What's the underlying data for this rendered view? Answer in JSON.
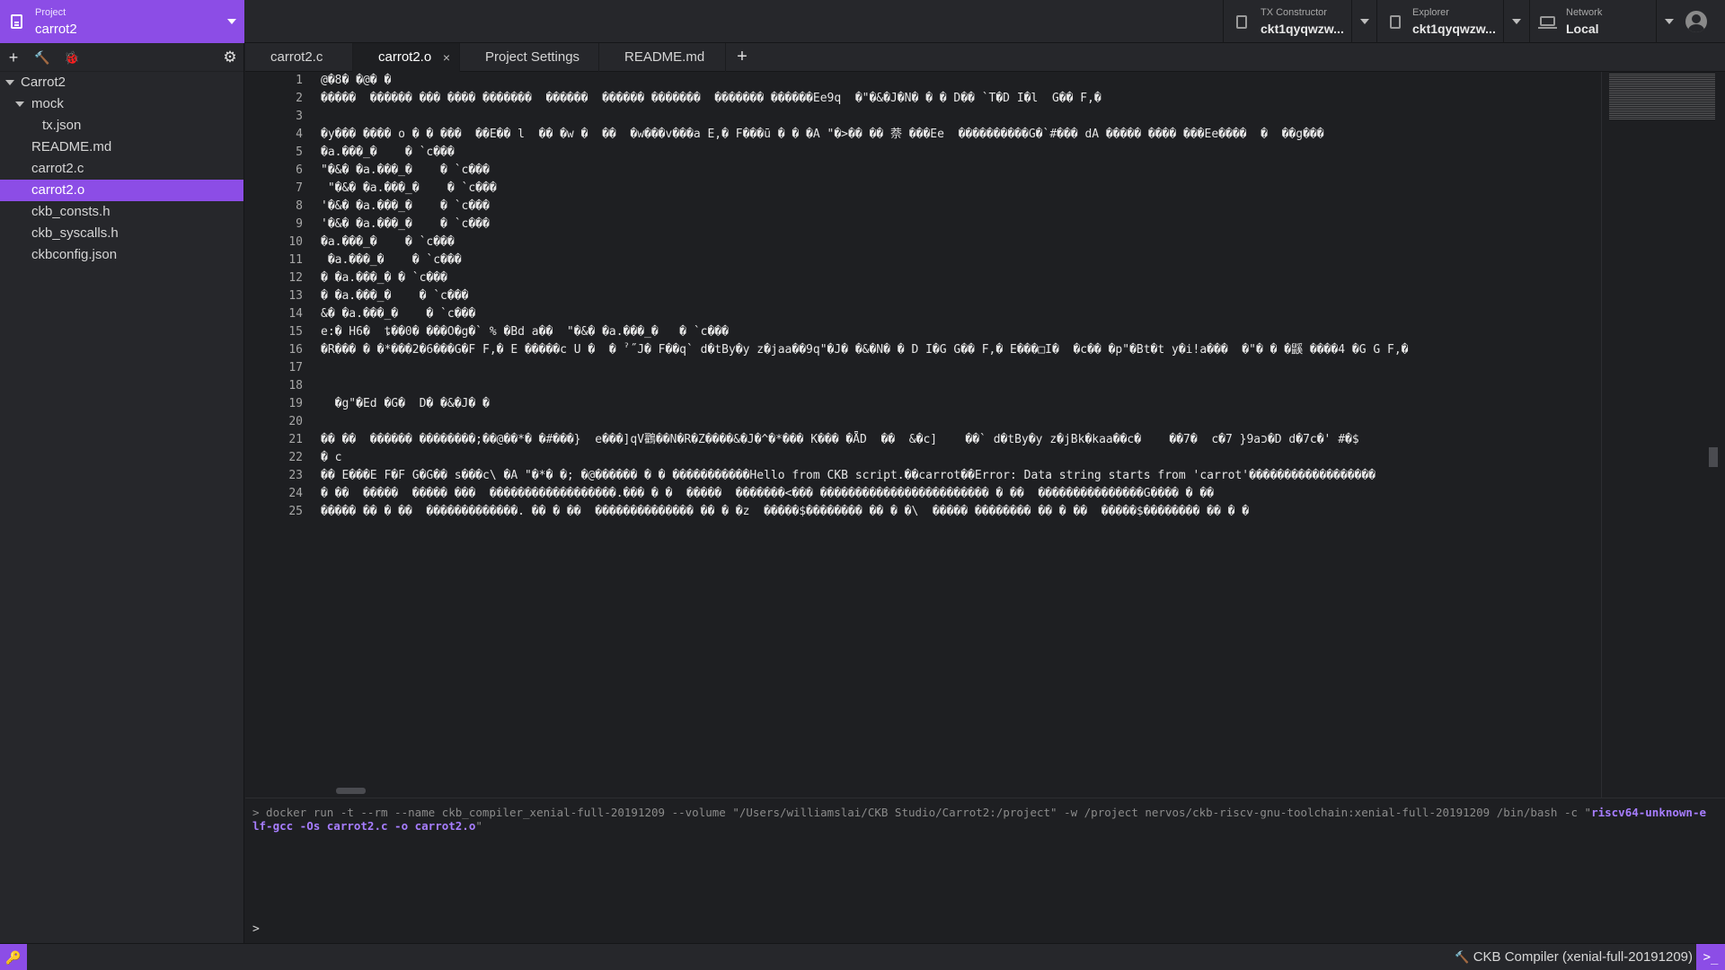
{
  "project_selector": {
    "caption": "Project",
    "value": "carrot2"
  },
  "tx_constructor": {
    "caption": "TX Constructor",
    "value": "ckt1qyqwzw..."
  },
  "explorer": {
    "caption": "Explorer",
    "value": "ckt1qyqwzw..."
  },
  "network": {
    "caption": "Network",
    "value": "Local"
  },
  "sidebar": {
    "toolbar": {
      "add": "+",
      "build": "🔨",
      "debug": "🐞",
      "settings": "⚙"
    },
    "tree": [
      {
        "label": "Carrot2",
        "expanded": true
      },
      {
        "label": "mock",
        "expanded": true
      },
      {
        "label": "tx.json"
      },
      {
        "label": "README.md"
      },
      {
        "label": "carrot2.c"
      },
      {
        "label": "carrot2.o",
        "selected": true
      },
      {
        "label": "ckb_consts.h"
      },
      {
        "label": "ckb_syscalls.h"
      },
      {
        "label": "ckbconfig.json"
      }
    ]
  },
  "tabs": [
    {
      "label": "carrot2.c"
    },
    {
      "label": "carrot2.o",
      "active": true,
      "close": "×"
    },
    {
      "label": "Project Settings"
    },
    {
      "label": "README.md"
    }
  ],
  "add_tab": "+",
  "editor": {
    "lines": [
      "@�8� �@� �",
      "�����  ������ ��� ���� �������  ������  ������ �������  ������� ������Ee9q  �\"�&�J�N� � � D�� `T�D I�l  G�� F,�",
      "",
      "�y��� ���� o � � ���  ��E�� l  �� �w �  ��  �w���v���a E,� F���ū � � �A \"�>�� �� 萘 ���Ee  ����������G�`#��� dA ����� ���� ���Ee����  �  ��g���",
      "�a.���_�    � `c���",
      "\"�&� �a.���_�    � `c���",
      " \"�&� �a.���_�    � `c���",
      "'�&� �a.���_�    � `c���",
      "'�&� �a.���_�    � `c���",
      "�a.���_�    � `c���",
      " �a.���_�    � `c���",
      "� �a.���_� � `c���",
      "� �a.���_�    � `c���",
      "&� �a.���_�    � `c���",
      "e:� H6�  ȶ��0� ���O�g�` % �Bd a��  \"�&� �a.���_�   � `c���",
      "�R��� � �*���2�6���G�F F,� E �����c U �  � ˀ˝J� F��q` d�tBy�y z�jaa��9q\"�J� �&�N� � D I�G G�� F,� E���□I�  �c�� �p\"�Bt�t y�i!a���  �\"� � �鼷 ����4 �G G F,�",
      "",
      "",
      "  �g\"�Ed �G�  D� �&�J� �",
      "",
      "�� ��  ������ ��������;��@��*� �#���}  e���]qV鸐��N�R�Z����&�J�^�*��� K��� �ǞD  ��  &�c]    ��` d�tBy�y z�jBk�kaa��c�    ��7�  c�7 }9aכ�D d�7c�' #�$",
      "� c",
      "�� E���E F�F G�G�� s���c\\ �A \"�*� �; �@������ � � �����������Hello from CKB script.��carrot��Error: Data string starts from 'carrot'������������������",
      "� ��  �����  ����� ���  ������������������.��� � �  �����  �������<��� ������������������������ � ��  ���������������G���� � ��",
      "����� �� � ��  �������������. �� � ��  �������������� �� � �z  �����$�������� �� � �\\  ����� �������� �� � ��  �����$�������� �� � �"
    ]
  },
  "terminal": {
    "command_prefix": "> docker run -t --rm --name ckb_compiler_xenial-full-20191209 --volume \"/Users/williamslai/CKB Studio/Carrot2:/project\" -w /project nervos/ckb-riscv-gnu-toolchain:xenial-full-20191209 /bin/bash -c \"",
    "command_highlight": "riscv64-unknown-elf-gcc -Os carrot2.c -o carrot2.o",
    "command_suffix": "\"",
    "prompt": ">"
  },
  "statusbar": {
    "key_icon": "🔑",
    "compiler_label": "CKB Compiler (xenial-full-20191209)",
    "compiler_icon": "🔨",
    "terminal_icon": ">_"
  }
}
